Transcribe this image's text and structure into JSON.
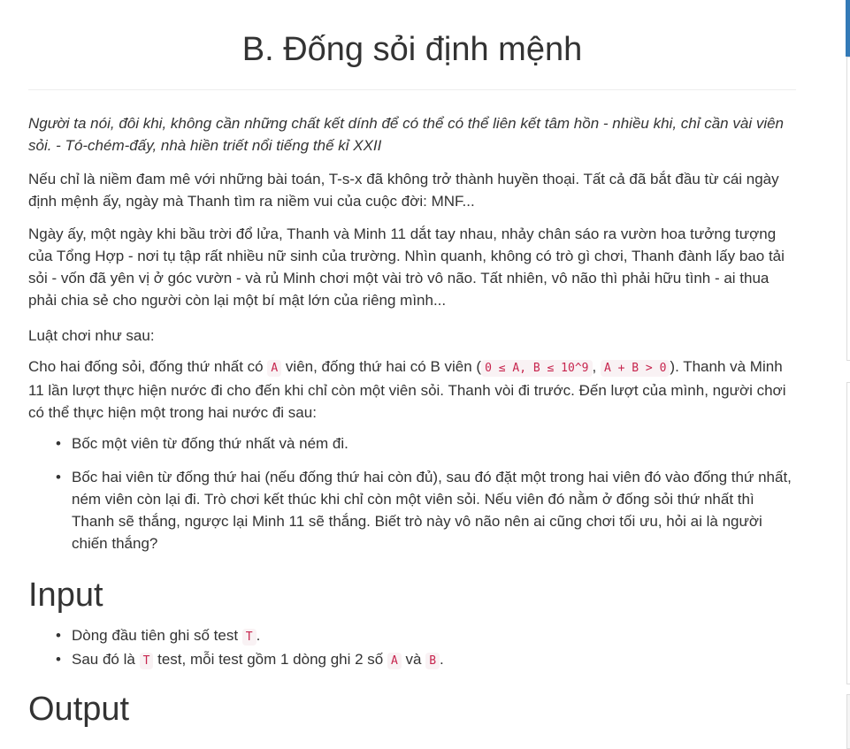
{
  "problem": {
    "title": "B. Đống sỏi định mệnh",
    "quote": "Người ta nói, đôi khi, không cần những chất kết dính để có thể có thể liên kết tâm hồn - nhiều khi, chỉ cần vài viên sỏi. - Tó-chém-đấy, nhà hiền triết nổi tiếng thế kỉ XXII",
    "para1": "Nếu chỉ là niềm đam mê với những bài toán, T-s-x đã không trở thành huyền thoại. Tất cả đã bắt đầu từ cái ngày định mệnh ấy, ngày mà Thanh tìm ra niềm vui của cuộc đời: MNF...",
    "para2": "Ngày ấy, một ngày khi bầu trời đổ lửa, Thanh và Minh 11 dắt tay nhau, nhảy chân sáo ra vườn hoa tưởng tượng của Tổng Hợp - nơi tụ tập rất nhiều nữ sinh của trường. Nhìn quanh, không có trò gì chơi, Thanh đành lấy bao tải sỏi - vốn đã yên vị ở góc vườn - và rủ Minh chơi một vài trò vô não. Tất nhiên, vô não thì phải hữu tình - ai thua phải chia sẻ cho người còn lại một bí mật lớn của riêng mình...",
    "para3": "Luật chơi như sau:",
    "para4": {
      "t1": "Cho hai đống sỏi, đống thứ nhất có ",
      "c1": "A",
      "t2": " viên, đống thứ hai có B viên (",
      "c2": "0 ≤ A, B ≤ 10^9",
      "t3": ", ",
      "c3": "A + B > 0",
      "t4": "). Thanh và Minh 11 lần lượt thực hiện nước đi cho đến khi chỉ còn một viên sỏi. Thanh vòi đi trước. Đến lượt của mình, người chơi có thể thực hiện một trong hai nước đi sau:"
    },
    "moves": [
      "Bốc một viên từ đống thứ nhất và ném đi.",
      "Bốc hai viên từ đống thứ hai (nếu đống thứ hai còn đủ), sau đó đặt một trong hai viên đó vào đống thứ nhất, ném viên còn lại đi. Trò chơi kết thúc khi chỉ còn một viên sỏi. Nếu viên đó nằm ở đống sỏi thứ nhất thì Thanh sẽ thắng, ngược lại Minh 11 sẽ thắng. Biết trò này vô não nên ai cũng chơi tối ưu, hỏi ai là người chiến thắng?"
    ],
    "input_heading": "Input",
    "input_items": {
      "line1": {
        "t1": "Dòng đầu tiên ghi số test ",
        "c1": "T",
        "t2": "."
      },
      "line2": {
        "t1": "Sau đó là ",
        "c1": "T",
        "t2": " test, mỗi test gồm 1 dòng ghi 2 số ",
        "c2": "A",
        "t3": " và ",
        "c3": "B",
        "t4": "."
      }
    },
    "output_heading": "Output"
  }
}
